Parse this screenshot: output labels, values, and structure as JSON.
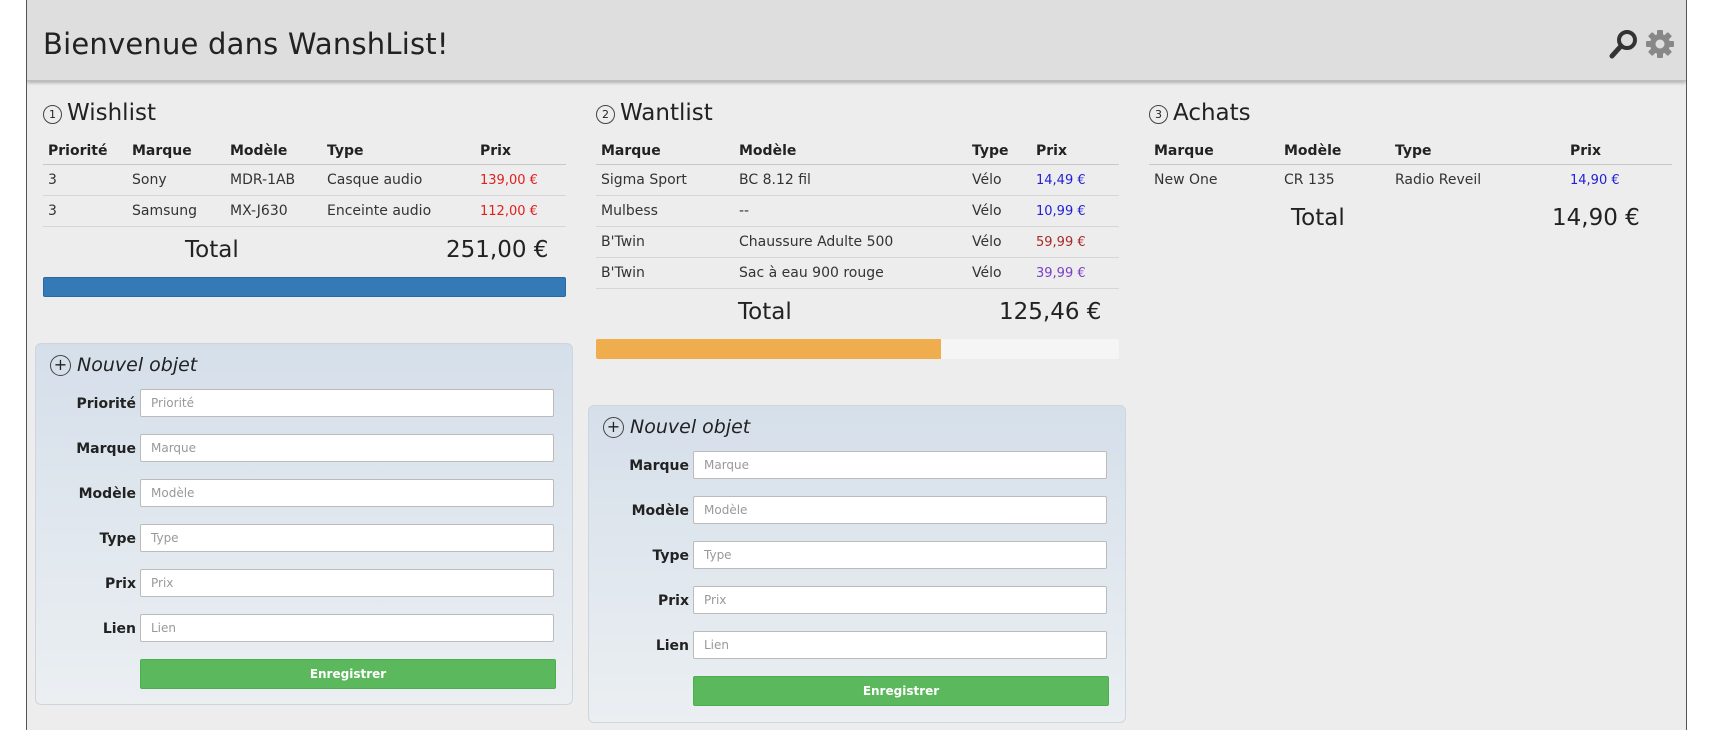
{
  "header": {
    "title": "Bienvenue dans WanshList!"
  },
  "icons": {
    "search": "search-icon",
    "settings": "gear-icon"
  },
  "colors": {
    "price_red": "#e0201e",
    "price_blue": "#1f1fd6",
    "price_darkred": "#a52a2a",
    "price_purple": "#7b3fc4",
    "wishlist_bar": "#337ab7",
    "wantlist_bar": "#f0ad4e",
    "save_button": "#5cb85c"
  },
  "wishlist": {
    "number": "1",
    "title": "Wishlist",
    "columns": [
      "Priorité",
      "Marque",
      "Modèle",
      "Type",
      "Prix"
    ],
    "rows": [
      {
        "priorite": "3",
        "marque": "Sony",
        "modele": "MDR-1AB",
        "type": "Casque audio",
        "prix": "139,00 €"
      },
      {
        "priorite": "3",
        "marque": "Samsung",
        "modele": "MX-J630",
        "type": "Enceinte audio",
        "prix": "112,00 €"
      }
    ],
    "total_label": "Total",
    "total_value": "251,00 €",
    "progress": 1.0,
    "form": {
      "title": "Nouvel objet",
      "fields": [
        {
          "label": "Priorité",
          "placeholder": "Priorité"
        },
        {
          "label": "Marque",
          "placeholder": "Marque"
        },
        {
          "label": "Modèle",
          "placeholder": "Modèle"
        },
        {
          "label": "Type",
          "placeholder": "Type"
        },
        {
          "label": "Prix",
          "placeholder": "Prix"
        },
        {
          "label": "Lien",
          "placeholder": "Lien"
        }
      ],
      "save_label": "Enregistrer"
    }
  },
  "wantlist": {
    "number": "2",
    "title": "Wantlist",
    "columns": [
      "Marque",
      "Modèle",
      "Type",
      "Prix"
    ],
    "rows": [
      {
        "marque": "Sigma Sport",
        "modele": "BC 8.12 fil",
        "type": "Vélo",
        "prix": "14,49 €"
      },
      {
        "marque": "Mulbess",
        "modele": "--",
        "type": "Vélo",
        "prix": "10,99 €"
      },
      {
        "marque": "B'Twin",
        "modele": "Chaussure Adulte 500",
        "type": "Vélo",
        "prix": "59,99 €"
      },
      {
        "marque": "B'Twin",
        "modele": "Sac à eau 900 rouge",
        "type": "Vélo",
        "prix": "39,99 €"
      }
    ],
    "total_label": "Total",
    "total_value": "125,46 €",
    "progress": 0.66,
    "form": {
      "title": "Nouvel objet",
      "fields": [
        {
          "label": "Marque",
          "placeholder": "Marque"
        },
        {
          "label": "Modèle",
          "placeholder": "Modèle"
        },
        {
          "label": "Type",
          "placeholder": "Type"
        },
        {
          "label": "Prix",
          "placeholder": "Prix"
        },
        {
          "label": "Lien",
          "placeholder": "Lien"
        }
      ],
      "save_label": "Enregistrer"
    }
  },
  "achats": {
    "number": "3",
    "title": "Achats",
    "columns": [
      "Marque",
      "Modèle",
      "Type",
      "Prix"
    ],
    "rows": [
      {
        "marque": "New One",
        "modele": "CR 135",
        "type": "Radio Reveil",
        "prix": "14,90 €"
      }
    ],
    "total_label": "Total",
    "total_value": "14,90 €"
  }
}
